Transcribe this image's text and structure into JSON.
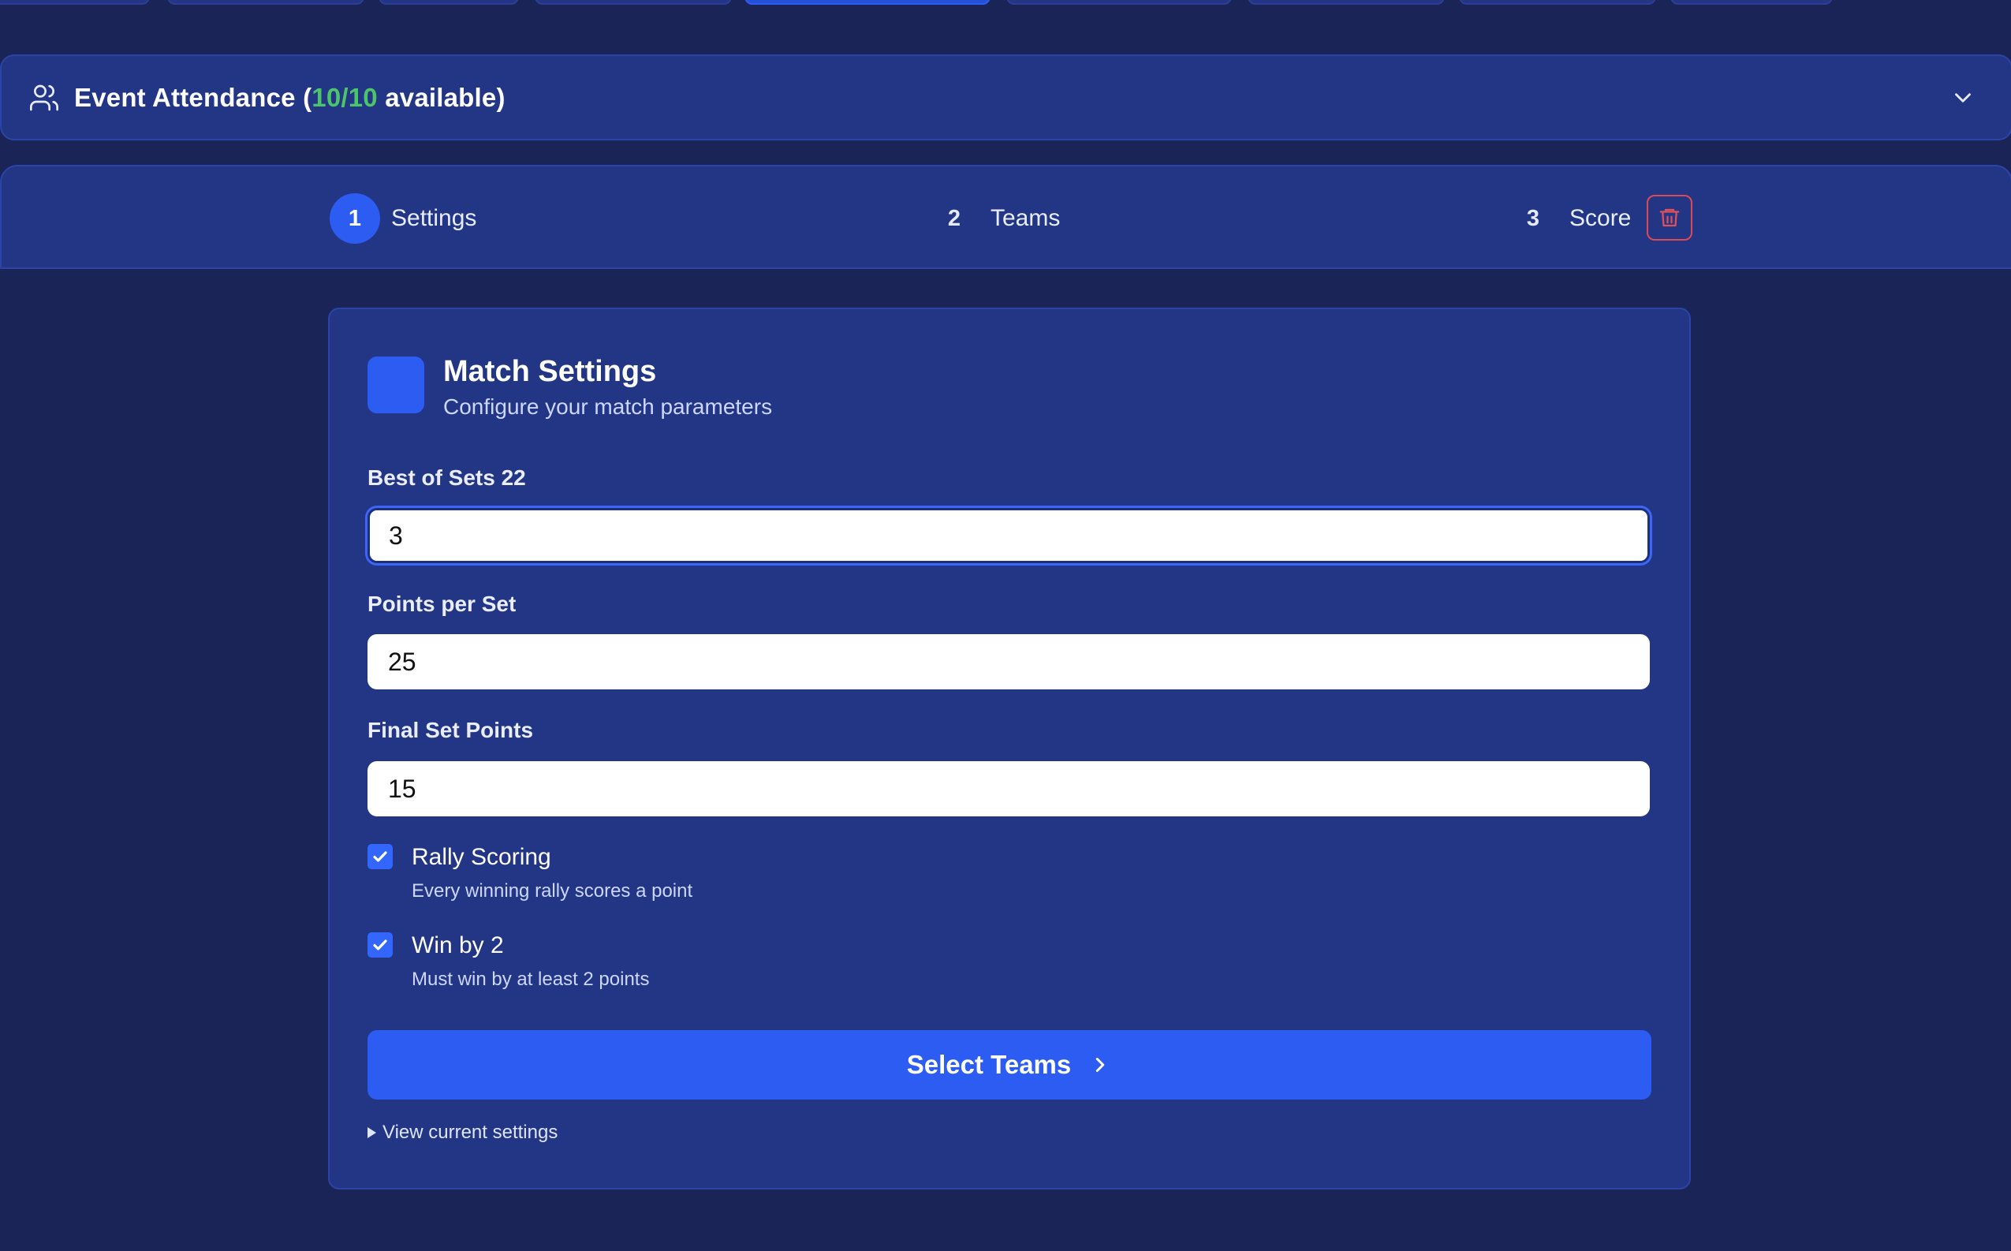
{
  "attendance": {
    "title_prefix": "Event Attendance (",
    "count": "10/10",
    "title_suffix": " available)"
  },
  "stepper": {
    "steps": [
      {
        "number": "1",
        "label": "Settings",
        "active": true
      },
      {
        "number": "2",
        "label": "Teams",
        "active": false
      },
      {
        "number": "3",
        "label": "Score",
        "active": false
      }
    ]
  },
  "card": {
    "title": "Match Settings",
    "subtitle": "Configure your match parameters"
  },
  "fields": {
    "best_of_sets": {
      "label": "Best of Sets 22",
      "value": "3"
    },
    "points_per_set": {
      "label": "Points per Set",
      "value": "25"
    },
    "final_set_points": {
      "label": "Final Set Points",
      "value": "15"
    }
  },
  "options": {
    "rally_scoring": {
      "label": "Rally Scoring",
      "description": "Every winning rally scores a point",
      "checked": true
    },
    "win_by_two": {
      "label": "Win by 2",
      "description": "Must win by at least 2 points",
      "checked": true
    }
  },
  "actions": {
    "select_teams": "Select Teams",
    "view_settings": "View current settings"
  },
  "colors": {
    "background": "#1b2456",
    "panel": "#233585",
    "accent": "#2d5cf2",
    "available": "#4cc46a",
    "danger": "#d94b55"
  },
  "icons": {
    "attendance": "users-icon",
    "expand": "chevron-down-icon",
    "delete": "trash-icon",
    "check": "check-icon",
    "next": "chevron-right-icon",
    "disclosure": "triangle-right-icon"
  }
}
